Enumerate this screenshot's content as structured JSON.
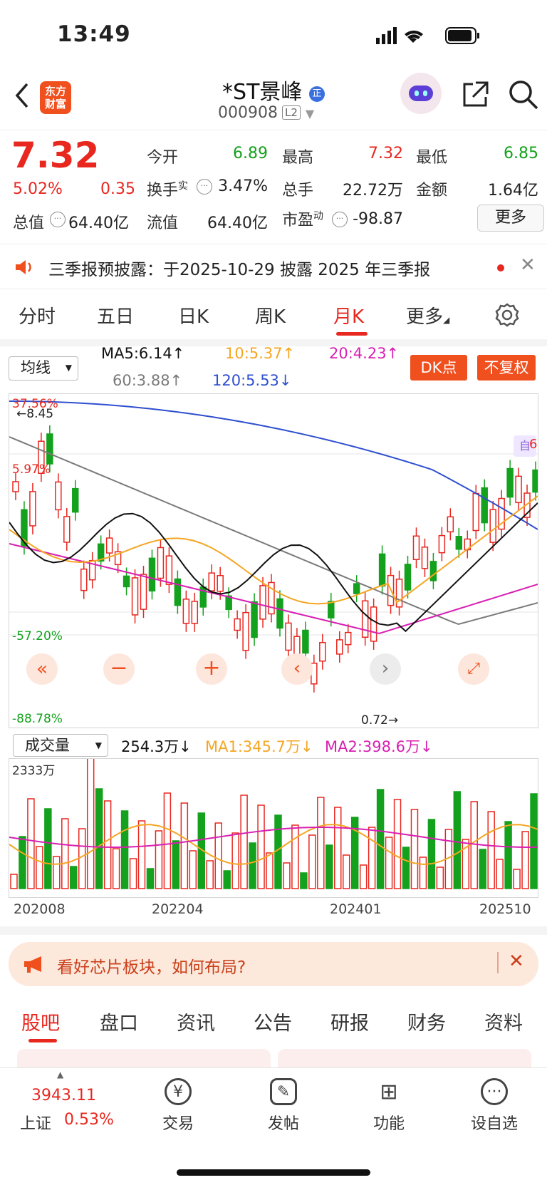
{
  "status": {
    "time": "13:49"
  },
  "header": {
    "logo": "东方财富",
    "title": "*ST景峰",
    "code": "000908",
    "level": "L2"
  },
  "quote": {
    "price": "7.32",
    "change_pct": "5.02%",
    "change": "0.35",
    "open_label": "今开",
    "open": "6.89",
    "high_label": "最高",
    "high": "7.32",
    "low_label": "最低",
    "low": "6.85",
    "turnover_label": "换手",
    "turnover_sup": "实",
    "turnover": "3.47%",
    "volume_label": "总手",
    "volume": "22.72万",
    "amount_label": "金额",
    "amount": "1.64亿",
    "mktcap_label": "总值",
    "mktcap": "64.40亿",
    "float_label": "流值",
    "float": "64.40亿",
    "pe_label": "市盈",
    "pe_sup": "动",
    "pe": "-98.87",
    "more": "更多"
  },
  "notice": {
    "text": "三季报预披露：于2025-10-29 披露 2025 年三季报"
  },
  "periods": {
    "tabs": [
      "分时",
      "五日",
      "日K",
      "周K",
      "月K",
      "更多"
    ],
    "active": "月K"
  },
  "indicators": {
    "ma_select": "均线",
    "ma5": "MA5:6.14↑",
    "ma10": "10:5.37↑",
    "ma20": "20:4.23↑",
    "ma60": "60:3.88↑",
    "ma120": "120:5.53↓",
    "dk_button": "DK点",
    "adjust_button": "不复权",
    "colors": {
      "ma5": "#111111",
      "ma10": "#f5a623",
      "ma20": "#d81fb3",
      "ma60": "#7a7a7a",
      "ma120": "#2f4fcf"
    }
  },
  "kline": {
    "axis_labels": [
      "37.56%",
      "5.97%",
      "-57.20%",
      "-88.78%"
    ],
    "max_label": "8.45",
    "min_label": "0.72",
    "marker_self": "自",
    "marker_num": "6"
  },
  "volume": {
    "select": "成交量",
    "current": "254.3万↓",
    "ma1": "MA1:345.7万↓",
    "ma2": "MA2:398.6万↓",
    "max_label": "2333万",
    "x_labels": [
      "202008",
      "202204",
      "202401",
      "202510"
    ]
  },
  "banner": {
    "text": "看好芯片板块，如何布局?"
  },
  "subtabs": [
    "股吧",
    "盘口",
    "资讯",
    "公告",
    "研报",
    "财务",
    "资料"
  ],
  "bottom": {
    "index_value": "3943.11",
    "index_name": "上证",
    "index_change": "0.53%",
    "nav": [
      "交易",
      "发帖",
      "功能",
      "设自选"
    ]
  }
}
